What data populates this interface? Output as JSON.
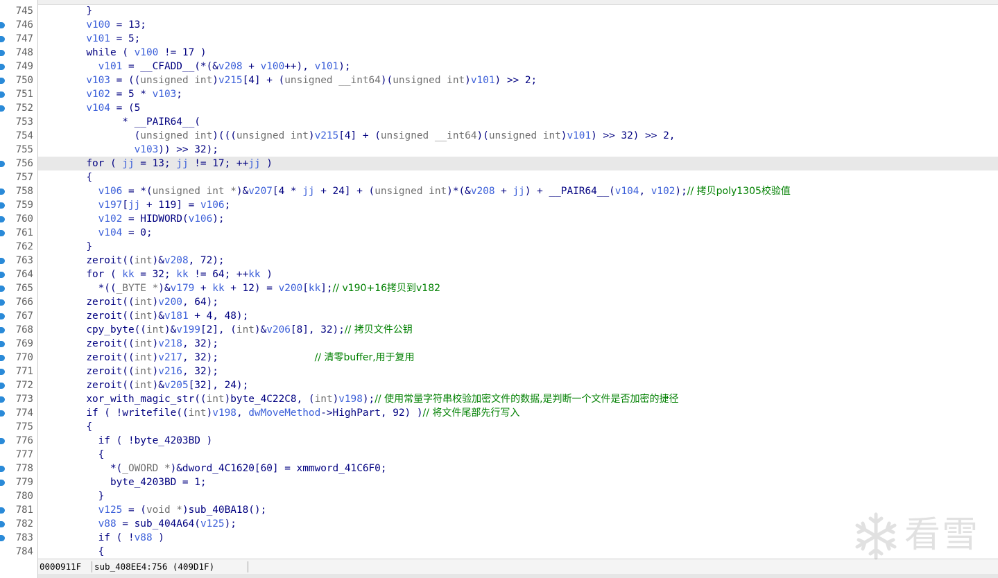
{
  "lines": [
    {
      "num": "745",
      "dot": false,
      "hl": false,
      "indent": "        ",
      "segs": [
        [
          "k",
          "}"
        ]
      ]
    },
    {
      "num": "746",
      "dot": true,
      "hl": false,
      "indent": "        ",
      "segs": [
        [
          "v",
          "v100"
        ],
        [
          "k",
          " = 13;"
        ]
      ]
    },
    {
      "num": "747",
      "dot": true,
      "hl": false,
      "indent": "        ",
      "segs": [
        [
          "v",
          "v101"
        ],
        [
          "k",
          " = 5;"
        ]
      ]
    },
    {
      "num": "748",
      "dot": true,
      "hl": false,
      "indent": "        ",
      "segs": [
        [
          "k",
          "while ( "
        ],
        [
          "v",
          "v100"
        ],
        [
          "k",
          " != 17 )"
        ]
      ]
    },
    {
      "num": "749",
      "dot": true,
      "hl": false,
      "indent": "          ",
      "segs": [
        [
          "v",
          "v101"
        ],
        [
          "k",
          " = __CFADD__(*(&"
        ],
        [
          "v",
          "v208"
        ],
        [
          "k",
          " + "
        ],
        [
          "v",
          "v100"
        ],
        [
          "k",
          "++), "
        ],
        [
          "v",
          "v101"
        ],
        [
          "k",
          ");"
        ]
      ]
    },
    {
      "num": "750",
      "dot": true,
      "hl": false,
      "indent": "        ",
      "segs": [
        [
          "v",
          "v103"
        ],
        [
          "k",
          " = (("
        ],
        [
          "g",
          "unsigned int"
        ],
        [
          "k",
          ")"
        ],
        [
          "v",
          "v215"
        ],
        [
          "k",
          "[4] + ("
        ],
        [
          "g",
          "unsigned __int64"
        ],
        [
          "k",
          ")("
        ],
        [
          "g",
          "unsigned int"
        ],
        [
          "k",
          ")"
        ],
        [
          "v",
          "v101"
        ],
        [
          "k",
          ") >> 2;"
        ]
      ]
    },
    {
      "num": "751",
      "dot": true,
      "hl": false,
      "indent": "        ",
      "segs": [
        [
          "v",
          "v102"
        ],
        [
          "k",
          " = 5 * "
        ],
        [
          "v",
          "v103"
        ],
        [
          "k",
          ";"
        ]
      ]
    },
    {
      "num": "752",
      "dot": true,
      "hl": false,
      "indent": "        ",
      "segs": [
        [
          "v",
          "v104"
        ],
        [
          "k",
          " = (5"
        ]
      ]
    },
    {
      "num": "753",
      "dot": false,
      "hl": false,
      "indent": "              ",
      "segs": [
        [
          "k",
          "* __PAIR64__("
        ]
      ]
    },
    {
      "num": "754",
      "dot": false,
      "hl": false,
      "indent": "                ",
      "segs": [
        [
          "k",
          "("
        ],
        [
          "g",
          "unsigned int"
        ],
        [
          "k",
          ")((("
        ],
        [
          "g",
          "unsigned int"
        ],
        [
          "k",
          ")"
        ],
        [
          "v",
          "v215"
        ],
        [
          "k",
          "[4] + ("
        ],
        [
          "g",
          "unsigned __int64"
        ],
        [
          "k",
          ")("
        ],
        [
          "g",
          "unsigned int"
        ],
        [
          "k",
          ")"
        ],
        [
          "v",
          "v101"
        ],
        [
          "k",
          ") >> 32) >> 2,"
        ]
      ]
    },
    {
      "num": "755",
      "dot": false,
      "hl": false,
      "indent": "                ",
      "segs": [
        [
          "v",
          "v103"
        ],
        [
          "k",
          ")) >> 32);"
        ]
      ]
    },
    {
      "num": "756",
      "dot": true,
      "hl": true,
      "indent": "        ",
      "segs": [
        [
          "k",
          "for ( "
        ],
        [
          "v",
          "jj"
        ],
        [
          "k",
          " = 13; "
        ],
        [
          "v",
          "jj"
        ],
        [
          "k",
          " != 17; ++"
        ],
        [
          "v",
          "jj"
        ],
        [
          "k",
          " )"
        ]
      ]
    },
    {
      "num": "757",
      "dot": false,
      "hl": false,
      "indent": "        ",
      "segs": [
        [
          "k",
          "{"
        ]
      ]
    },
    {
      "num": "758",
      "dot": true,
      "hl": false,
      "indent": "          ",
      "segs": [
        [
          "v",
          "v106"
        ],
        [
          "k",
          " = *("
        ],
        [
          "g",
          "unsigned int *"
        ],
        [
          "k",
          ")&"
        ],
        [
          "v",
          "v207"
        ],
        [
          "k",
          "[4 * "
        ],
        [
          "v",
          "jj"
        ],
        [
          "k",
          " + 24] + ("
        ],
        [
          "g",
          "unsigned int"
        ],
        [
          "k",
          ")*(&"
        ],
        [
          "v",
          "v208"
        ],
        [
          "k",
          " + "
        ],
        [
          "v",
          "jj"
        ],
        [
          "k",
          ") + __PAIR64__("
        ],
        [
          "v",
          "v104"
        ],
        [
          "k",
          ", "
        ],
        [
          "v",
          "v102"
        ],
        [
          "k",
          ");"
        ],
        [
          "c",
          "// 拷贝poly1305校验值"
        ]
      ]
    },
    {
      "num": "759",
      "dot": true,
      "hl": false,
      "indent": "          ",
      "segs": [
        [
          "v",
          "v197"
        ],
        [
          "k",
          "["
        ],
        [
          "v",
          "jj"
        ],
        [
          "k",
          " + 119] = "
        ],
        [
          "v",
          "v106"
        ],
        [
          "k",
          ";"
        ]
      ]
    },
    {
      "num": "760",
      "dot": true,
      "hl": false,
      "indent": "          ",
      "segs": [
        [
          "v",
          "v102"
        ],
        [
          "k",
          " = HIDWORD("
        ],
        [
          "v",
          "v106"
        ],
        [
          "k",
          ");"
        ]
      ]
    },
    {
      "num": "761",
      "dot": true,
      "hl": false,
      "indent": "          ",
      "segs": [
        [
          "v",
          "v104"
        ],
        [
          "k",
          " = 0;"
        ]
      ]
    },
    {
      "num": "762",
      "dot": false,
      "hl": false,
      "indent": "        ",
      "segs": [
        [
          "k",
          "}"
        ]
      ]
    },
    {
      "num": "763",
      "dot": true,
      "hl": false,
      "indent": "        ",
      "segs": [
        [
          "k",
          "zeroit(("
        ],
        [
          "g",
          "int"
        ],
        [
          "k",
          ")&"
        ],
        [
          "v",
          "v208"
        ],
        [
          "k",
          ", 72);"
        ]
      ]
    },
    {
      "num": "764",
      "dot": true,
      "hl": false,
      "indent": "        ",
      "segs": [
        [
          "k",
          "for ( "
        ],
        [
          "v",
          "kk"
        ],
        [
          "k",
          " = 32; "
        ],
        [
          "v",
          "kk"
        ],
        [
          "k",
          " != 64; ++"
        ],
        [
          "v",
          "kk"
        ],
        [
          "k",
          " )"
        ]
      ]
    },
    {
      "num": "765",
      "dot": true,
      "hl": false,
      "indent": "          ",
      "segs": [
        [
          "k",
          "*(("
        ],
        [
          "g",
          "_BYTE *"
        ],
        [
          "k",
          ")&"
        ],
        [
          "v",
          "v179"
        ],
        [
          "k",
          " + "
        ],
        [
          "v",
          "kk"
        ],
        [
          "k",
          " + 12) = "
        ],
        [
          "v",
          "v200"
        ],
        [
          "k",
          "["
        ],
        [
          "v",
          "kk"
        ],
        [
          "k",
          "];"
        ],
        [
          "c",
          "// v190+16拷贝到v182"
        ]
      ]
    },
    {
      "num": "766",
      "dot": true,
      "hl": false,
      "indent": "        ",
      "segs": [
        [
          "k",
          "zeroit(("
        ],
        [
          "g",
          "int"
        ],
        [
          "k",
          ")"
        ],
        [
          "v",
          "v200"
        ],
        [
          "k",
          ", 64);"
        ]
      ]
    },
    {
      "num": "767",
      "dot": true,
      "hl": false,
      "indent": "        ",
      "segs": [
        [
          "k",
          "zeroit(("
        ],
        [
          "g",
          "int"
        ],
        [
          "k",
          ")&"
        ],
        [
          "v",
          "v181"
        ],
        [
          "k",
          " + 4, 48);"
        ]
      ]
    },
    {
      "num": "768",
      "dot": true,
      "hl": false,
      "indent": "        ",
      "segs": [
        [
          "k",
          "cpy_byte(("
        ],
        [
          "g",
          "int"
        ],
        [
          "k",
          ")&"
        ],
        [
          "v",
          "v199"
        ],
        [
          "k",
          "[2], ("
        ],
        [
          "g",
          "int"
        ],
        [
          "k",
          ")&"
        ],
        [
          "v",
          "v206"
        ],
        [
          "k",
          "[8], 32);"
        ],
        [
          "c",
          "// 拷贝文件公钥"
        ]
      ]
    },
    {
      "num": "769",
      "dot": true,
      "hl": false,
      "indent": "        ",
      "segs": [
        [
          "k",
          "zeroit(("
        ],
        [
          "g",
          "int"
        ],
        [
          "k",
          ")"
        ],
        [
          "v",
          "v218"
        ],
        [
          "k",
          ", 32);"
        ]
      ]
    },
    {
      "num": "770",
      "dot": true,
      "hl": false,
      "indent": "        ",
      "segs": [
        [
          "k",
          "zeroit(("
        ],
        [
          "g",
          "int"
        ],
        [
          "k",
          ")"
        ],
        [
          "v",
          "v217"
        ],
        [
          "k",
          ", 32);                "
        ],
        [
          "c",
          "// 清零buffer,用于复用"
        ]
      ]
    },
    {
      "num": "771",
      "dot": true,
      "hl": false,
      "indent": "        ",
      "segs": [
        [
          "k",
          "zeroit(("
        ],
        [
          "g",
          "int"
        ],
        [
          "k",
          ")"
        ],
        [
          "v",
          "v216"
        ],
        [
          "k",
          ", 32);"
        ]
      ]
    },
    {
      "num": "772",
      "dot": true,
      "hl": false,
      "indent": "        ",
      "segs": [
        [
          "k",
          "zeroit(("
        ],
        [
          "g",
          "int"
        ],
        [
          "k",
          ")&"
        ],
        [
          "v",
          "v205"
        ],
        [
          "k",
          "[32], 24);"
        ]
      ]
    },
    {
      "num": "773",
      "dot": true,
      "hl": false,
      "indent": "        ",
      "segs": [
        [
          "k",
          "xor_with_magic_str(("
        ],
        [
          "g",
          "int"
        ],
        [
          "k",
          ")byte_4C22C8, ("
        ],
        [
          "g",
          "int"
        ],
        [
          "k",
          ")"
        ],
        [
          "v",
          "v198"
        ],
        [
          "k",
          ");"
        ],
        [
          "c",
          "// 使用常量字符串校验加密文件的数据,是判断一个文件是否加密的捷径"
        ]
      ]
    },
    {
      "num": "774",
      "dot": true,
      "hl": false,
      "indent": "        ",
      "segs": [
        [
          "k",
          "if ( !writefile(("
        ],
        [
          "g",
          "int"
        ],
        [
          "k",
          ")"
        ],
        [
          "v",
          "v198"
        ],
        [
          "k",
          ", "
        ],
        [
          "v",
          "dwMoveMethod"
        ],
        [
          "k",
          "->HighPart, 92) )"
        ],
        [
          "c",
          "// 将文件尾部先行写入"
        ]
      ]
    },
    {
      "num": "775",
      "dot": false,
      "hl": false,
      "indent": "        ",
      "segs": [
        [
          "k",
          "{"
        ]
      ]
    },
    {
      "num": "776",
      "dot": true,
      "hl": false,
      "indent": "          ",
      "segs": [
        [
          "k",
          "if ( !byte_4203BD )"
        ]
      ]
    },
    {
      "num": "777",
      "dot": false,
      "hl": false,
      "indent": "          ",
      "segs": [
        [
          "k",
          "{"
        ]
      ]
    },
    {
      "num": "778",
      "dot": true,
      "hl": false,
      "indent": "            ",
      "segs": [
        [
          "k",
          "*("
        ],
        [
          "g",
          "_OWORD *"
        ],
        [
          "k",
          ")&dword_4C1620[60] = xmmword_41C6F0;"
        ]
      ]
    },
    {
      "num": "779",
      "dot": true,
      "hl": false,
      "indent": "            ",
      "segs": [
        [
          "k",
          "byte_4203BD = 1;"
        ]
      ]
    },
    {
      "num": "780",
      "dot": false,
      "hl": false,
      "indent": "          ",
      "segs": [
        [
          "k",
          "}"
        ]
      ]
    },
    {
      "num": "781",
      "dot": true,
      "hl": false,
      "indent": "          ",
      "segs": [
        [
          "v",
          "v125"
        ],
        [
          "k",
          " = ("
        ],
        [
          "g",
          "void *"
        ],
        [
          "k",
          ")sub_40BA18();"
        ]
      ]
    },
    {
      "num": "782",
      "dot": true,
      "hl": false,
      "indent": "          ",
      "segs": [
        [
          "v",
          "v88"
        ],
        [
          "k",
          " = sub_404A64("
        ],
        [
          "v",
          "v125"
        ],
        [
          "k",
          ");"
        ]
      ]
    },
    {
      "num": "783",
      "dot": true,
      "hl": false,
      "indent": "          ",
      "segs": [
        [
          "k",
          "if ( !"
        ],
        [
          "v",
          "v88"
        ],
        [
          "k",
          " )"
        ]
      ]
    },
    {
      "num": "784",
      "dot": false,
      "hl": false,
      "indent": "          ",
      "segs": [
        [
          "k",
          "{"
        ]
      ]
    }
  ],
  "status": {
    "address": "0000911F",
    "location": "sub_408EE4:756 (409D1F)"
  },
  "watermark": {
    "text": "看雪",
    "icon": "snowflake-icon"
  },
  "colors": {
    "keyword": "#000080",
    "variable": "#3b5fd9",
    "type": "#707070",
    "comment": "#008000",
    "highlight": "#e8e8e8",
    "gutter_dot": "#2a8ad8"
  }
}
